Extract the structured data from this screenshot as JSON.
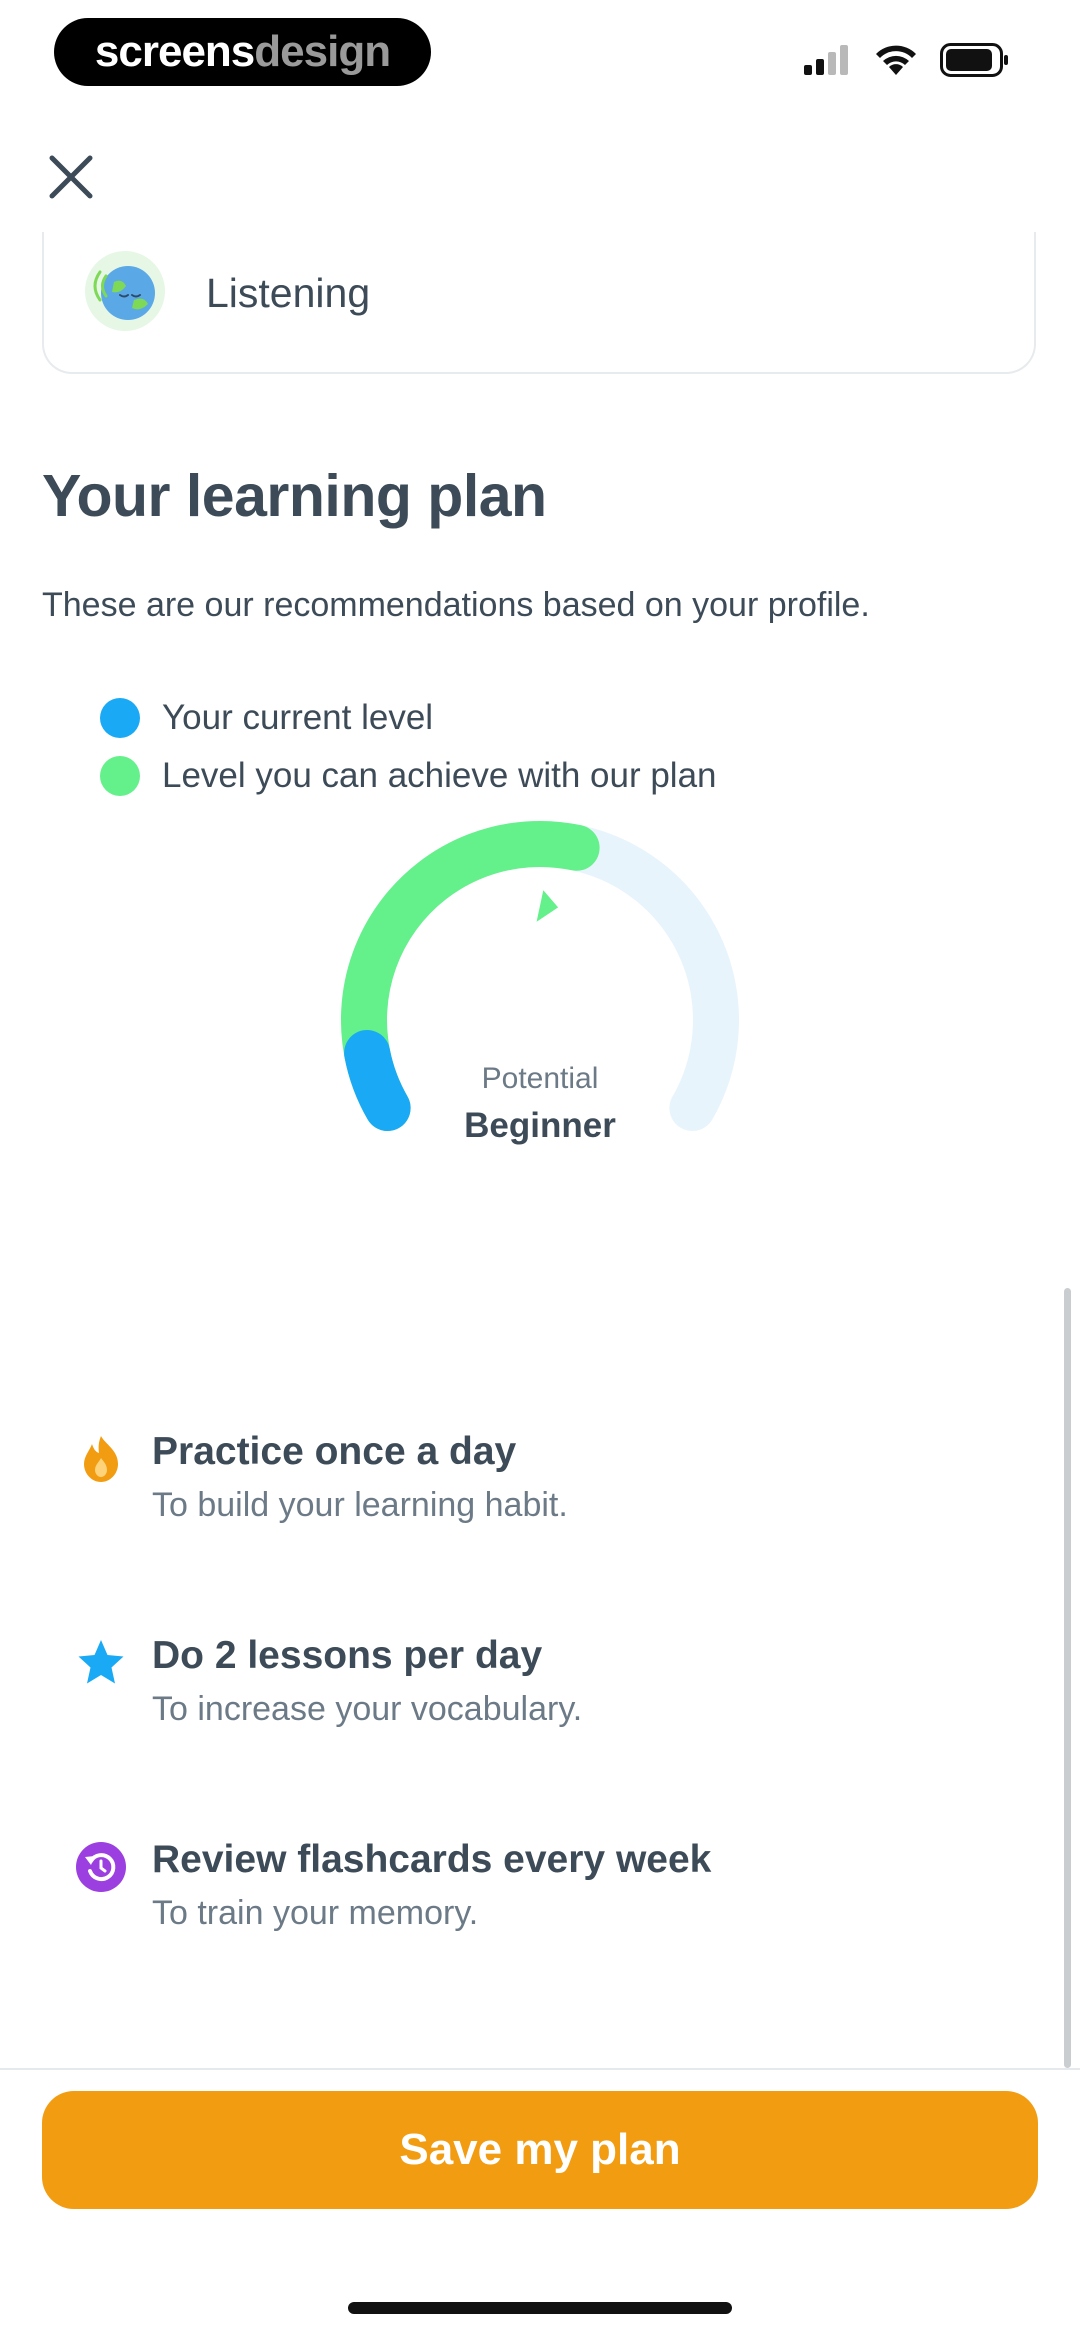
{
  "status_bar": {
    "brand_part1": "screens",
    "brand_part2": "design"
  },
  "skill": {
    "label": "Listening"
  },
  "plan": {
    "title": "Your learning plan",
    "subtitle": "These are our recommendations based on your profile."
  },
  "legend": [
    {
      "label": "Your current level",
      "color": "#1aa9f5"
    },
    {
      "label": "Level you can achieve with our plan",
      "color": "#64f08a"
    }
  ],
  "gauge": {
    "caption": "Potential",
    "level": "Beginner",
    "current_level_fraction": 0.08,
    "potential_level_fraction": 0.55,
    "colors": {
      "current": "#1aa9f5",
      "potential": "#64f08a",
      "track": "#e8f4fc"
    }
  },
  "tips": [
    {
      "icon": "flame-icon",
      "title": "Practice once a day",
      "description": "To build your learning habit.",
      "color": "#f29c12"
    },
    {
      "icon": "star-icon",
      "title": "Do 2 lessons per day",
      "description": "To increase your vocabulary.",
      "color": "#1aa9f5"
    },
    {
      "icon": "review-icon",
      "title": "Review flashcards every week",
      "description": "To train your memory.",
      "color": "#9b3fe0"
    }
  ],
  "footer": {
    "save_label": "Save my plan",
    "button_color": "#f29c12"
  }
}
